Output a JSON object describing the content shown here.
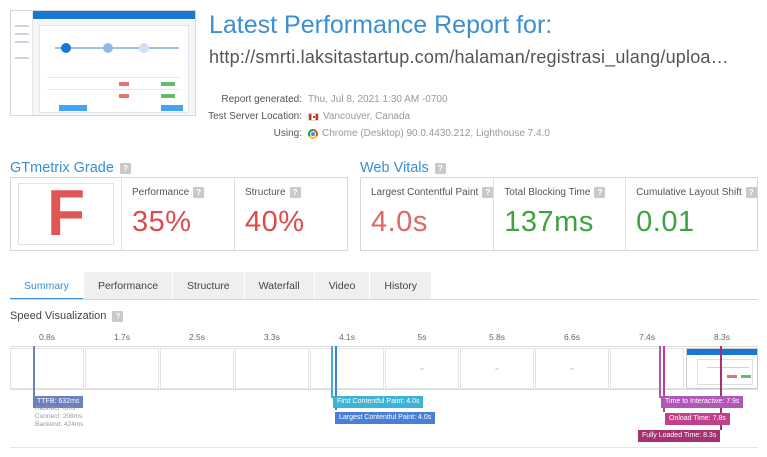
{
  "header": {
    "title": "Latest Performance Report for:",
    "url": "http://smrti.laksitastartup.com/halaman/registrasi_ulang/uploa…"
  },
  "meta": [
    {
      "key": "Report generated:",
      "value": "Thu, Jul 8, 2021 1:30 AM -0700",
      "icon": ""
    },
    {
      "key": "Test Server Location:",
      "value": "Vancouver, Canada",
      "icon": "canada-flag-icon"
    },
    {
      "key": "Using:",
      "value": "Chrome (Desktop) 90.0.4430.212, Lighthouse 7.4.0",
      "icon": "chrome-icon"
    }
  ],
  "grade": {
    "section_title": "GTmetrix Grade",
    "letter": "F",
    "metrics": [
      {
        "label": "Performance",
        "value": "35%",
        "color": "#dd4b4b"
      },
      {
        "label": "Structure",
        "value": "40%",
        "color": "#dd4b4b"
      }
    ]
  },
  "vitals": {
    "section_title": "Web Vitals",
    "metrics": [
      {
        "label": "Largest Contentful Paint",
        "value": "4.0s",
        "color": "#e06666"
      },
      {
        "label": "Total Blocking Time",
        "value": "137ms",
        "color": "#3ea33e"
      },
      {
        "label": "Cumulative Layout Shift",
        "value": "0.01",
        "color": "#3ea33e"
      }
    ]
  },
  "tabs": [
    {
      "label": "Summary",
      "active": true
    },
    {
      "label": "Performance",
      "active": false
    },
    {
      "label": "Structure",
      "active": false
    },
    {
      "label": "Waterfall",
      "active": false
    },
    {
      "label": "Video",
      "active": false
    },
    {
      "label": "History",
      "active": false
    }
  ],
  "speed": {
    "title": "Speed Visualization",
    "ticks": [
      "0.8s",
      "1.7s",
      "2.5s",
      "3.3s",
      "4.1s",
      "5s",
      "5.8s",
      "6.6s",
      "7.4s",
      "8.3s"
    ],
    "markers": {
      "ttfb": "TTFB: 632ms",
      "ttfb_details": [
        "Redirect: 0ms",
        "Connect: 208ms",
        "Backend: 424ms"
      ],
      "fcp": "First Contentful Paint: 4.0s",
      "lcp": "Largest Contentful Paint: 4.0s",
      "tti": "Time to Interactive: 7.9s",
      "onload": "Onload Time: 7.8s",
      "fully_loaded": "Fully Loaded Time: 8.3s"
    },
    "colors": {
      "ttfb": "#6c7fbf",
      "fcp": "#3fb3d6",
      "lcp": "#4a7fd6",
      "tti": "#b157b8",
      "onload": "#c2408a",
      "fully_loaded": "#a3326f"
    }
  }
}
